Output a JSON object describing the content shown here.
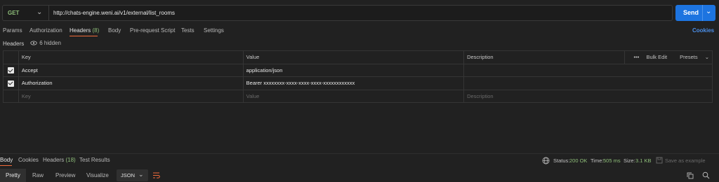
{
  "request": {
    "method": "GET",
    "url": "http://chats-engine.weni.ai/v1/external/list_rooms",
    "send_label": "Send"
  },
  "tabs": [
    {
      "label": "Params"
    },
    {
      "label": "Authorization"
    },
    {
      "label": "Headers",
      "count": "(8)"
    },
    {
      "label": "Body"
    },
    {
      "label": "Pre-request Script"
    },
    {
      "label": "Tests"
    },
    {
      "label": "Settings"
    }
  ],
  "cookies_label": "Cookies",
  "headers_section": {
    "title": "Headers",
    "hidden_label": "6 hidden"
  },
  "table": {
    "columns": {
      "key": "Key",
      "value": "Value",
      "description": "Description"
    },
    "tools": {
      "more": "•••",
      "bulk_edit": "Bulk Edit",
      "presets": "Presets"
    },
    "rows": [
      {
        "key": "Accept",
        "value": "application/json",
        "description": ""
      },
      {
        "key": "Authorization",
        "value": "Bearer xxxxxxxx-xxxx-xxxx-xxxx-xxxxxxxxxxxx",
        "description": ""
      }
    ],
    "placeholders": {
      "key": "Key",
      "value": "Value",
      "description": "Description"
    }
  },
  "response": {
    "tabs": [
      {
        "label": "Body"
      },
      {
        "label": "Cookies"
      },
      {
        "label": "Headers",
        "count": "(18)"
      },
      {
        "label": "Test Results"
      }
    ],
    "status_label": "Status:",
    "status_value": "200 OK",
    "time_label": "Time:",
    "time_value": "505 ms",
    "size_label": "Size:",
    "size_value": "3.1 KB",
    "save_label": "Save as example",
    "format_tabs": [
      "Pretty",
      "Raw",
      "Preview",
      "Visualize"
    ],
    "format": "JSON"
  },
  "colors": {
    "accent": "#f26b3a",
    "send": "#1d74e0",
    "ok": "#8fbf7a",
    "link": "#4b8ee8"
  }
}
